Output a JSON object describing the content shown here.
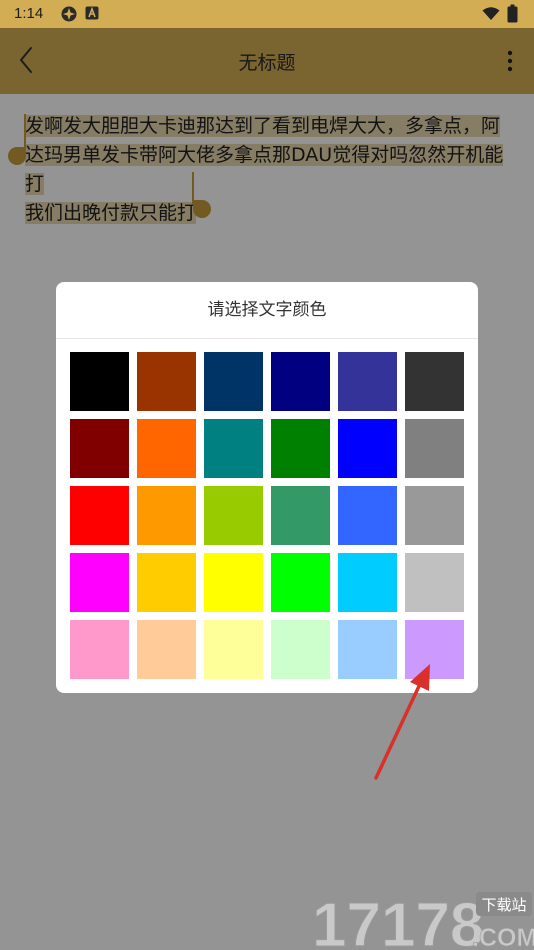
{
  "status_bar": {
    "time": "1:14"
  },
  "toolbar": {
    "title": "无标题"
  },
  "editor": {
    "lines": [
      "发啊发大胆胆大卡迪那达到了看到电焊大大，多拿点，阿",
      "达玛男单发卡带阿大佬多拿点那DAU觉得对吗忽然开机能打",
      "我们出晚付款只能打"
    ]
  },
  "dialog": {
    "title": "请选择文字颜色",
    "colors": [
      "#000000",
      "#993300",
      "#003366",
      "#000080",
      "#333399",
      "#333333",
      "#800000",
      "#FF6600",
      "#008080",
      "#008000",
      "#0000FF",
      "#808080",
      "#FF0000",
      "#FF9900",
      "#99CC00",
      "#339966",
      "#3366FF",
      "#999999",
      "#FF00FF",
      "#FFCC00",
      "#FFFF00",
      "#00FF00",
      "#00CCFF",
      "#C0C0C0",
      "#FF99CC",
      "#FFCC99",
      "#FFFF99",
      "#CCFFCC",
      "#99CCFF",
      "#CC99FF"
    ]
  },
  "watermark": {
    "main": "17178",
    "badge": "下载站",
    "domain": ".COM"
  },
  "theme": {
    "accent": "#d2ad54",
    "arrow": "#d9302c"
  }
}
